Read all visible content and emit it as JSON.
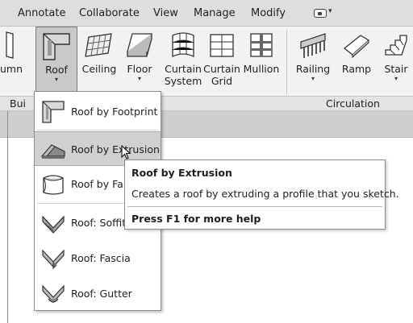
{
  "menubar": {
    "tabs": [
      "Annotate",
      "Collaborate",
      "View",
      "Manage",
      "Modify"
    ],
    "quick_access_icon": "window-icon",
    "quick_access_caret": "▾"
  },
  "ribbon": {
    "buttons": [
      {
        "label": "umn",
        "icon": "column-icon"
      },
      {
        "label": "Roof",
        "icon": "roof-icon",
        "caret": "▾",
        "active": true
      },
      {
        "label": "Ceiling",
        "icon": "ceiling-icon"
      },
      {
        "label": "Floor",
        "icon": "floor-icon",
        "caret": "▾"
      },
      {
        "label": "Curtain System",
        "line1": "Curtain",
        "line2": "System",
        "icon": "curtain-system-icon"
      },
      {
        "label": "Curtain Grid",
        "line1": "Curtain",
        "line2": "Grid",
        "icon": "curtain-grid-icon"
      },
      {
        "label": "Mullion",
        "icon": "mullion-icon"
      },
      {
        "label": "Railing",
        "icon": "railing-icon",
        "caret": "▾"
      },
      {
        "label": "Ramp",
        "icon": "ramp-icon"
      },
      {
        "label": "Stair",
        "icon": "stair-icon",
        "caret": "▾"
      }
    ],
    "panels": [
      "Bui",
      "Circulation"
    ]
  },
  "dropdown": {
    "items": [
      {
        "label": "Roof by Footprint",
        "icon": "roof-footprint-icon"
      },
      {
        "label": "Roof by Extrusion",
        "icon": "roof-extrusion-icon",
        "highlighted": true
      },
      {
        "label": "Roof by Fa",
        "icon": "roof-face-icon"
      },
      {
        "label": "Roof: Soffit",
        "icon": "roof-soffit-icon"
      },
      {
        "label": "Roof: Fascia",
        "icon": "roof-fascia-icon"
      },
      {
        "label": "Roof: Gutter",
        "icon": "roof-gutter-icon"
      }
    ]
  },
  "tooltip": {
    "title": "Roof by Extrusion",
    "description": "Creates a roof by extruding a profile that you sketch.",
    "help": "Press F1 for more help"
  },
  "colors": {
    "menubar_bg": "#dedede",
    "ribbon_bg": "#f2f2f2",
    "active_button_bg": "#c9c9c9",
    "highlight_bg": "#d0d0d0"
  }
}
